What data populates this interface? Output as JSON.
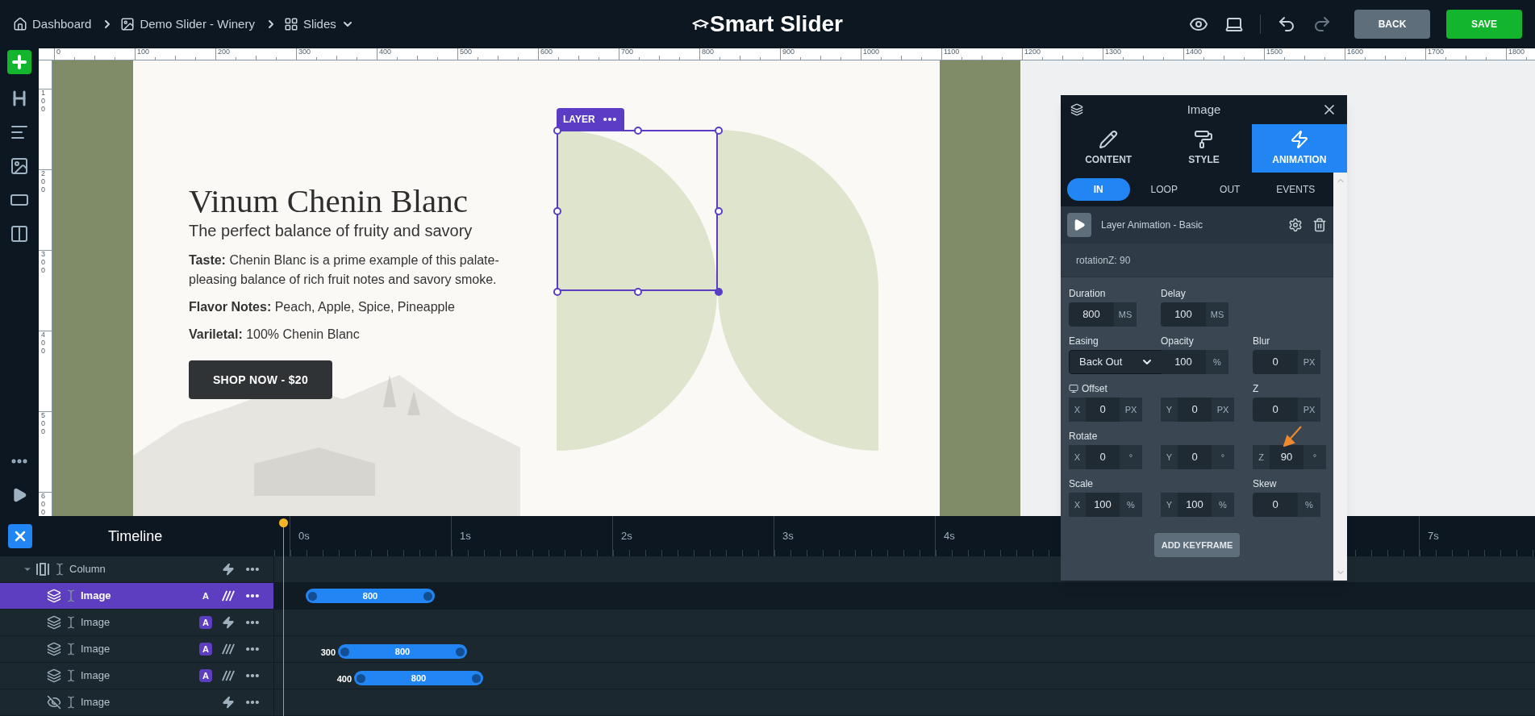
{
  "topbar": {
    "breadcrumbs": [
      {
        "label": "Dashboard",
        "dropdown": false
      },
      {
        "label": "Demo Slider - Winery",
        "dropdown": false
      },
      {
        "label": "Slides",
        "dropdown": true
      }
    ],
    "logo": "Smart Slider",
    "buttons": [
      {
        "label": "BACK",
        "kind": "secondary"
      },
      {
        "label": "SAVE",
        "kind": "primary"
      }
    ]
  },
  "ruler": {
    "horizontal": [
      "0",
      "100",
      "200",
      "300",
      "400",
      "500",
      "600",
      "700",
      "800",
      "900",
      "1000",
      "1100",
      "1200",
      "1300",
      "1400",
      "1500",
      "1600",
      "1700",
      "1800"
    ],
    "vertical": [
      "100",
      "200",
      "300",
      "400",
      "500",
      "600"
    ]
  },
  "slide": {
    "title": "Vinum Chenin Blanc",
    "subtitle": "The perfect balance of fruity and savory",
    "paragraphs": [
      "**Taste:** Chenin Blanc is a prime example of this palate-pleasing balance of rich fruit notes and savory smoke.",
      "**Flavor Notes:** Peach, Apple, Spice, Pineapple",
      "**Variletal:** 100% Chenin Blanc"
    ],
    "button": "SHOP NOW - $20",
    "layer_tag": "LAYER"
  },
  "panel": {
    "title": "Image",
    "tabs": [
      {
        "label": "CONTENT",
        "selected": false
      },
      {
        "label": "STYLE",
        "selected": false
      },
      {
        "label": "ANIMATION",
        "selected": true
      }
    ],
    "subtabs": [
      {
        "label": "IN",
        "selected": true
      },
      {
        "label": "LOOP",
        "selected": false
      },
      {
        "label": "OUT",
        "selected": false
      },
      {
        "label": "EVENTS",
        "selected": false
      }
    ],
    "animation": "Layer Animation - Basic",
    "summary": "rotationZ: 90",
    "rows": [
      {
        "fields": [
          {
            "kind": "input",
            "label": "Duration",
            "value": "800",
            "unit": "MS"
          },
          {
            "kind": "input",
            "label": "Delay",
            "value": "100",
            "unit": "MS"
          }
        ]
      },
      {
        "fields": [
          {
            "kind": "select",
            "label": "Easing",
            "value": "Back Out"
          },
          {
            "kind": "input",
            "label": "Opacity",
            "value": "100",
            "unit": "%"
          },
          {
            "kind": "input",
            "label": "Blur",
            "value": "0",
            "unit": "PX"
          }
        ]
      },
      {
        "fields": [
          {
            "kind": "input",
            "label": "Offset",
            "device_icon": true,
            "axis": "X",
            "value": "0",
            "unit": "PX"
          },
          {
            "kind": "input",
            "axis": "Y",
            "value": "0",
            "unit": "PX"
          },
          {
            "kind": "input",
            "label": "Z",
            "value": "0",
            "unit": "PX"
          }
        ]
      },
      {
        "fields": [
          {
            "kind": "input",
            "label": "Rotate",
            "axis": "X",
            "value": "0",
            "unit": "°"
          },
          {
            "kind": "input",
            "axis": "Y",
            "value": "0",
            "unit": "°"
          },
          {
            "kind": "input",
            "axis": "Z",
            "value": "90",
            "unit": "°",
            "annotated": true
          }
        ]
      },
      {
        "fields": [
          {
            "kind": "input",
            "label": "Scale",
            "axis": "X",
            "value": "100",
            "unit": "%"
          },
          {
            "kind": "input",
            "axis": "Y",
            "value": "100",
            "unit": "%"
          },
          {
            "kind": "input",
            "label": "Skew",
            "value": "0",
            "unit": "%"
          }
        ]
      }
    ],
    "button": "ADD KEYFRAME"
  },
  "timeline": {
    "title": "Timeline",
    "ticks": [
      "0s",
      "1s",
      "2s",
      "3s",
      "4s",
      "7s"
    ],
    "layers": [
      {
        "kind": "column",
        "label": "Column",
        "expanded": true,
        "animated": false,
        "children": [
          {
            "kind": "image",
            "label": "Image",
            "hidden": false,
            "selected": true,
            "badge": "A",
            "animated": true,
            "bar": {
              "duration": "800"
            }
          },
          {
            "kind": "image",
            "label": "Image",
            "hidden": false,
            "selected": false,
            "badge": "A",
            "animated": false
          },
          {
            "kind": "image",
            "label": "Image",
            "hidden": false,
            "selected": false,
            "badge": "A",
            "animated": true,
            "bar": {
              "delay": "300",
              "duration": "800"
            }
          },
          {
            "kind": "image",
            "label": "Image",
            "hidden": false,
            "selected": false,
            "badge": "A",
            "animated": true,
            "bar": {
              "delay": "400",
              "duration": "800"
            }
          },
          {
            "kind": "image",
            "label": "Image",
            "hidden": true,
            "selected": false,
            "animated": false
          }
        ]
      }
    ]
  }
}
